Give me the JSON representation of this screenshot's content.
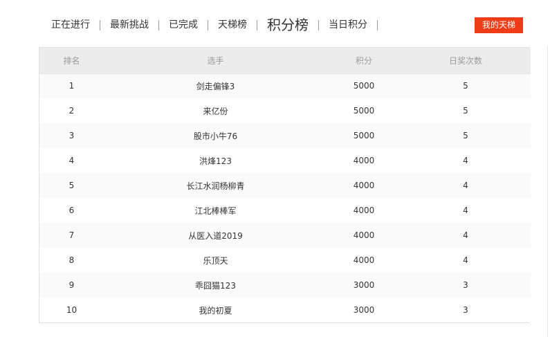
{
  "tabs": [
    {
      "label": "正在进行",
      "active": false
    },
    {
      "label": "最新挑战",
      "active": false
    },
    {
      "label": "已完成",
      "active": false
    },
    {
      "label": "天梯榜",
      "active": false
    },
    {
      "label": "积分榜",
      "active": true
    },
    {
      "label": "当日积分",
      "active": false
    }
  ],
  "my_ladder_button": "我的天梯",
  "table": {
    "headers": [
      "排名",
      "选手",
      "积分",
      "日奖次数"
    ],
    "rows": [
      [
        "1",
        "剑走偏锋3",
        "5000",
        "5"
      ],
      [
        "2",
        "来亿份",
        "5000",
        "5"
      ],
      [
        "3",
        "股市小牛76",
        "5000",
        "5"
      ],
      [
        "4",
        "洪烽123",
        "4000",
        "4"
      ],
      [
        "5",
        "长江水润杨柳青",
        "4000",
        "4"
      ],
      [
        "6",
        "江北棒棒军",
        "4000",
        "4"
      ],
      [
        "7",
        "从医入道2019",
        "4000",
        "4"
      ],
      [
        "8",
        "乐顶天",
        "4000",
        "4"
      ],
      [
        "9",
        "乖囧猫123",
        "3000",
        "3"
      ],
      [
        "10",
        "我的初夏",
        "3000",
        "3"
      ]
    ]
  },
  "colors": {
    "accent": "#ee3c17",
    "header_bg": "#ececec",
    "row_alt_bg": "#fafafa"
  }
}
